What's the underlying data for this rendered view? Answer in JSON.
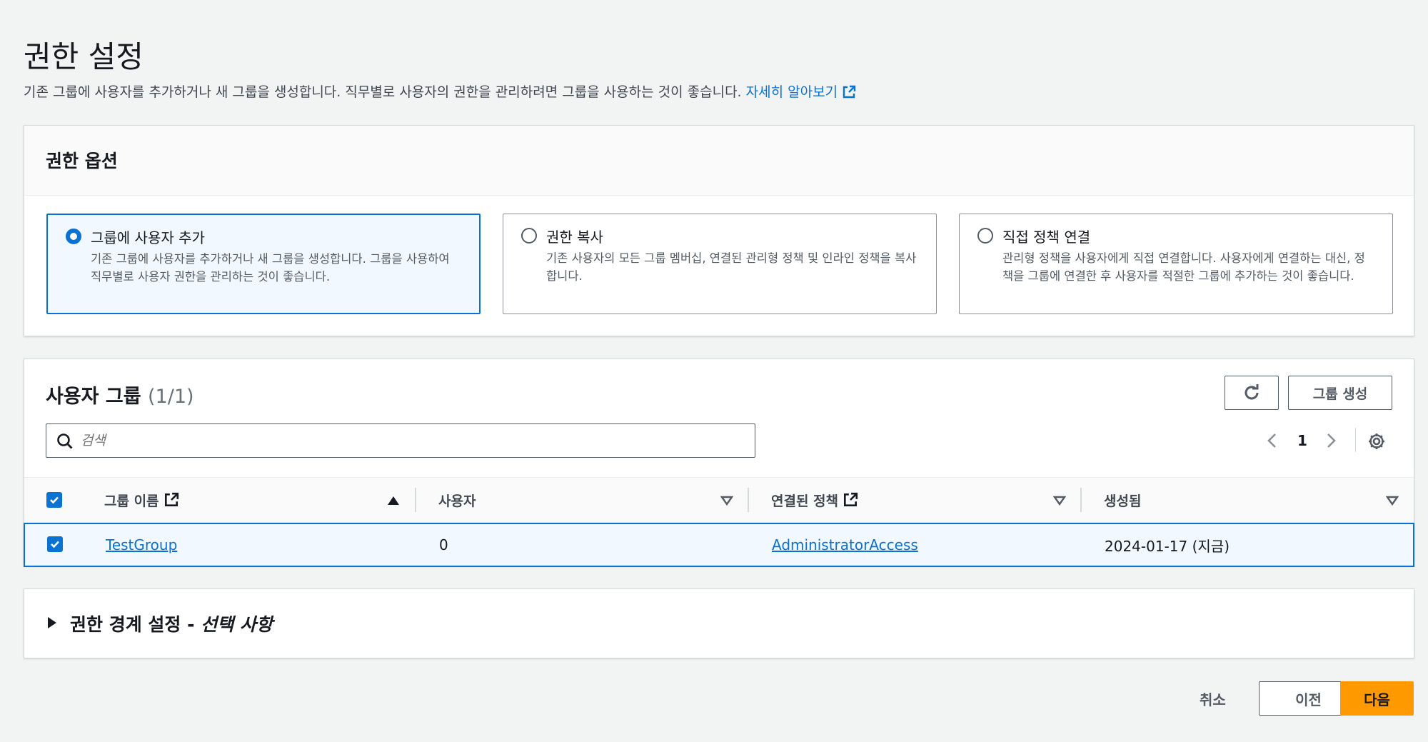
{
  "page": {
    "title": "권한 설정",
    "description": "기존 그룹에 사용자를 추가하거나 새 그룹을 생성합니다. 직무별로 사용자의 권한을 관리하려면 그룹을 사용하는 것이 좋습니다.",
    "learn_more": "자세히 알아보기"
  },
  "options_panel": {
    "title": "권한 옵션",
    "options": [
      {
        "title": "그룹에 사용자 추가",
        "desc": "기존 그룹에 사용자를 추가하거나 새 그룹을 생성합니다. 그룹을 사용하여 직무별로 사용자 권한을 관리하는 것이 좋습니다.",
        "selected": true
      },
      {
        "title": "권한 복사",
        "desc": "기존 사용자의 모든 그룹 멤버십, 연결된 관리형 정책 및 인라인 정책을 복사합니다.",
        "selected": false
      },
      {
        "title": "직접 정책 연결",
        "desc": "관리형 정책을 사용자에게 직접 연결합니다. 사용자에게 연결하는 대신, 정책을 그룹에 연결한 후 사용자를 적절한 그룹에 추가하는 것이 좋습니다.",
        "selected": false
      }
    ]
  },
  "groups_panel": {
    "title": "사용자 그룹",
    "count": "(1/1)",
    "create_button": "그룹 생성",
    "search_placeholder": "검색",
    "page_number": "1",
    "columns": [
      "그룹 이름",
      "사용자",
      "연결된 정책",
      "생성됨"
    ],
    "rows": [
      {
        "name": "TestGroup",
        "users": "0",
        "policy": "AdministratorAccess",
        "created": "2024-01-17 (지금)",
        "checked": true
      }
    ]
  },
  "boundary_panel": {
    "title": "권한 경계 설정 - ",
    "optional": "선택 사항"
  },
  "footer": {
    "cancel": "취소",
    "previous": "이전",
    "next": "다음"
  },
  "colors": {
    "accent": "#0972d3",
    "primary_button": "#ff9900",
    "background": "#f2f3f3"
  }
}
